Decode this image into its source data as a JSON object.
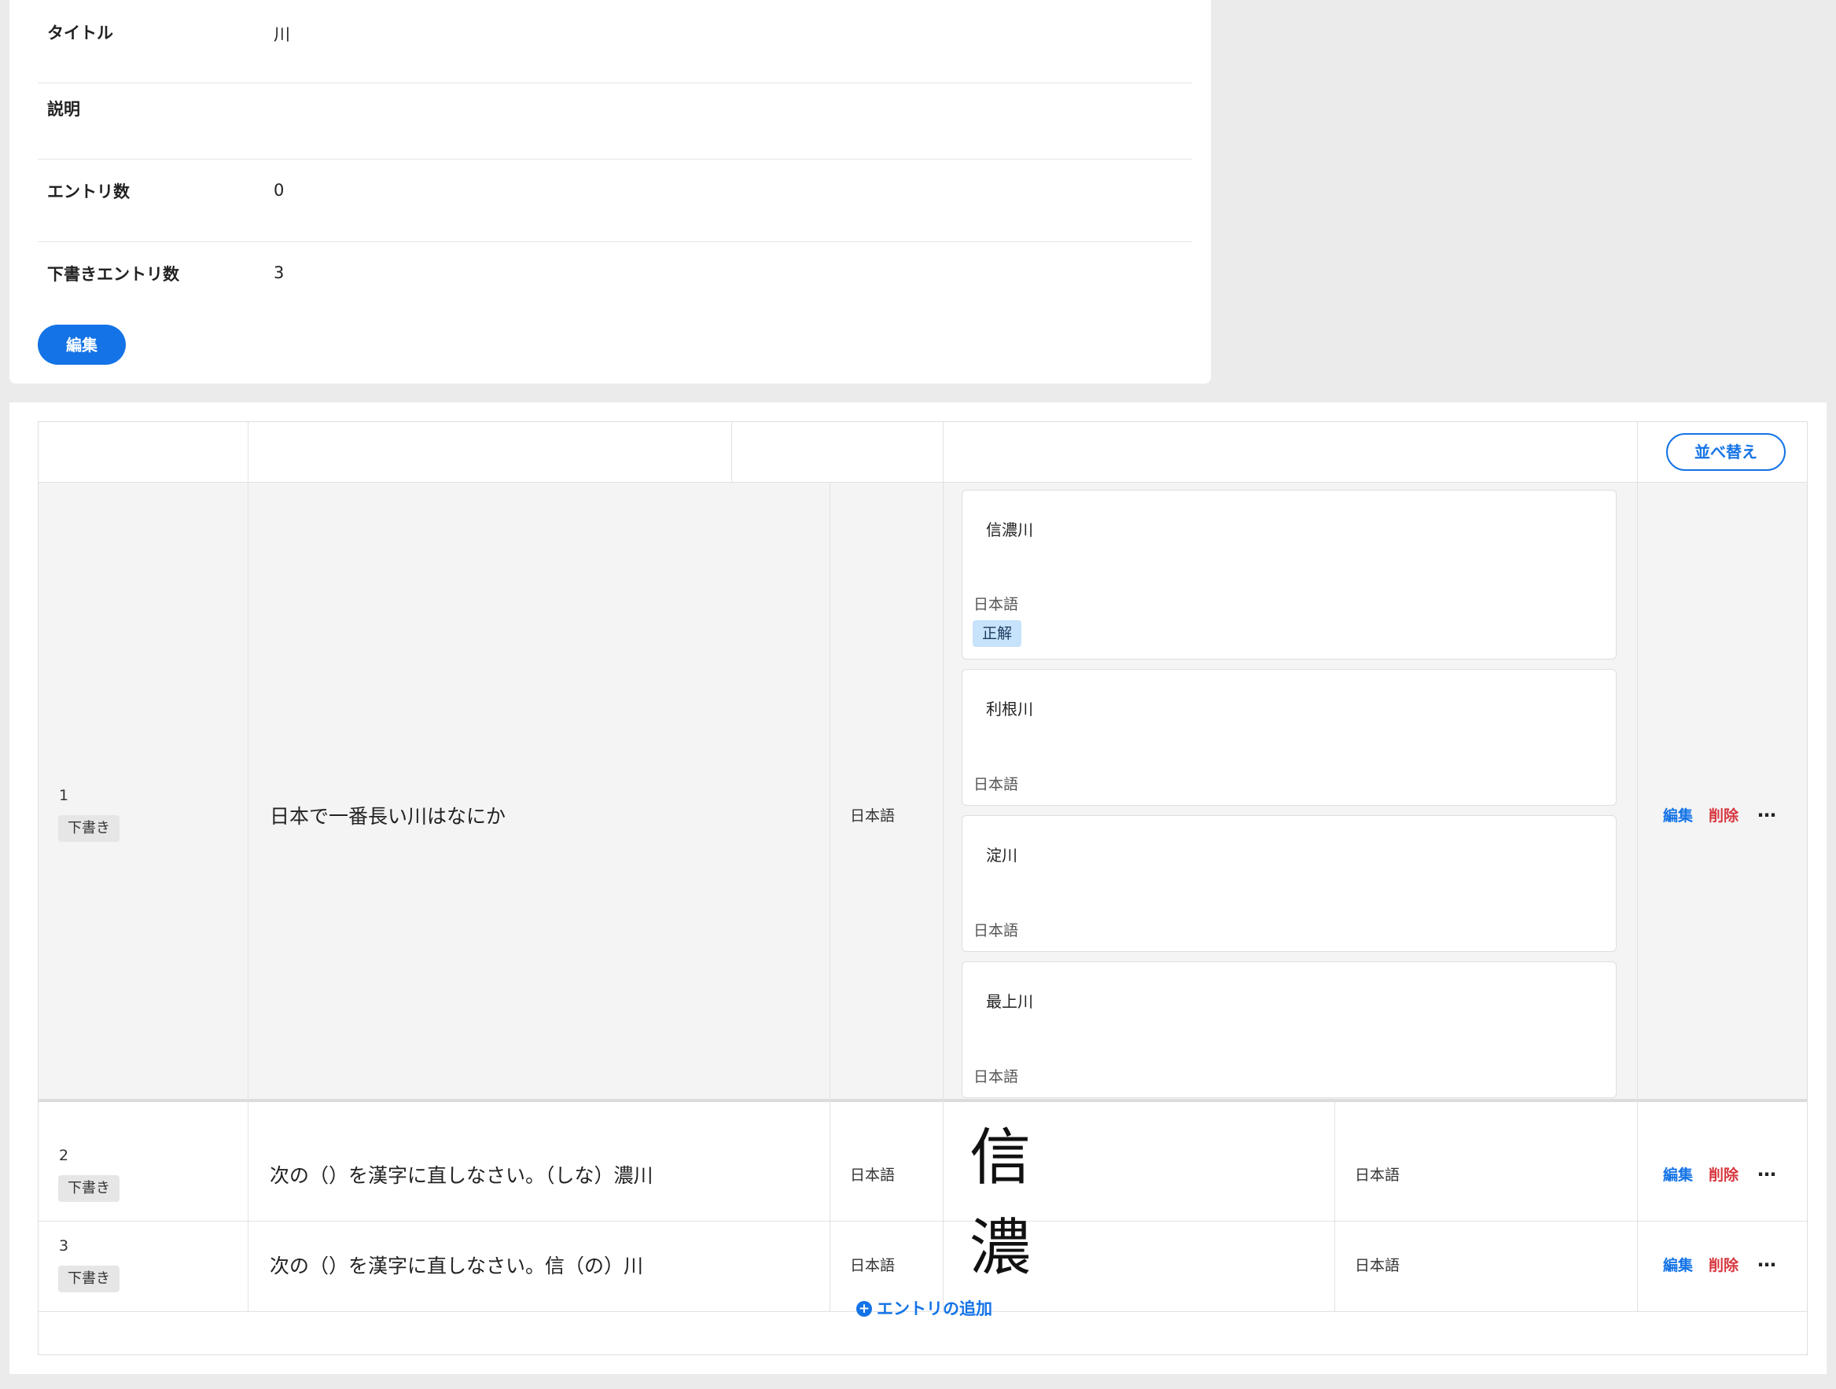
{
  "details": {
    "rows": [
      {
        "label": "タイトル",
        "value": "川"
      },
      {
        "label": "説明",
        "value": ""
      },
      {
        "label": "エントリ数",
        "value": "0"
      },
      {
        "label": "下書きエントリ数",
        "value": "3"
      }
    ],
    "edit_label": "編集"
  },
  "table": {
    "sort_label": "並べ替え",
    "entries": [
      {
        "number": "1",
        "status": "下書き",
        "question": "日本で一番長い川はなにか",
        "question_lang": "日本語",
        "answers": [
          {
            "text": "信濃川",
            "lang": "日本語",
            "badge": "正解"
          },
          {
            "text": "利根川",
            "lang": "日本語"
          },
          {
            "text": "淀川",
            "lang": "日本語"
          },
          {
            "text": "最上川",
            "lang": "日本語"
          }
        ],
        "edit": "編集",
        "delete": "削除",
        "more": "…"
      },
      {
        "number": "2",
        "status": "下書き",
        "question": "次の（）を漢字に直しなさい。（しな）濃川",
        "question_lang": "日本語",
        "answer_glyph": "信",
        "answer_lang": "日本語",
        "edit": "編集",
        "delete": "削除",
        "more": "…"
      },
      {
        "number": "3",
        "status": "下書き",
        "question": "次の（）を漢字に直しなさい。信（の）川",
        "question_lang": "日本語",
        "answer_glyph": "濃",
        "answer_lang": "日本語",
        "edit": "編集",
        "delete": "削除",
        "more": "…"
      }
    ],
    "add_entry_label": "エントリの追加",
    "add_entry_icon": "plus-circle-icon"
  },
  "colors": {
    "accent": "#1473e6",
    "danger": "#d7373f",
    "correct_badge_bg": "#c7e2fb",
    "page_bg": "#ebebeb"
  }
}
